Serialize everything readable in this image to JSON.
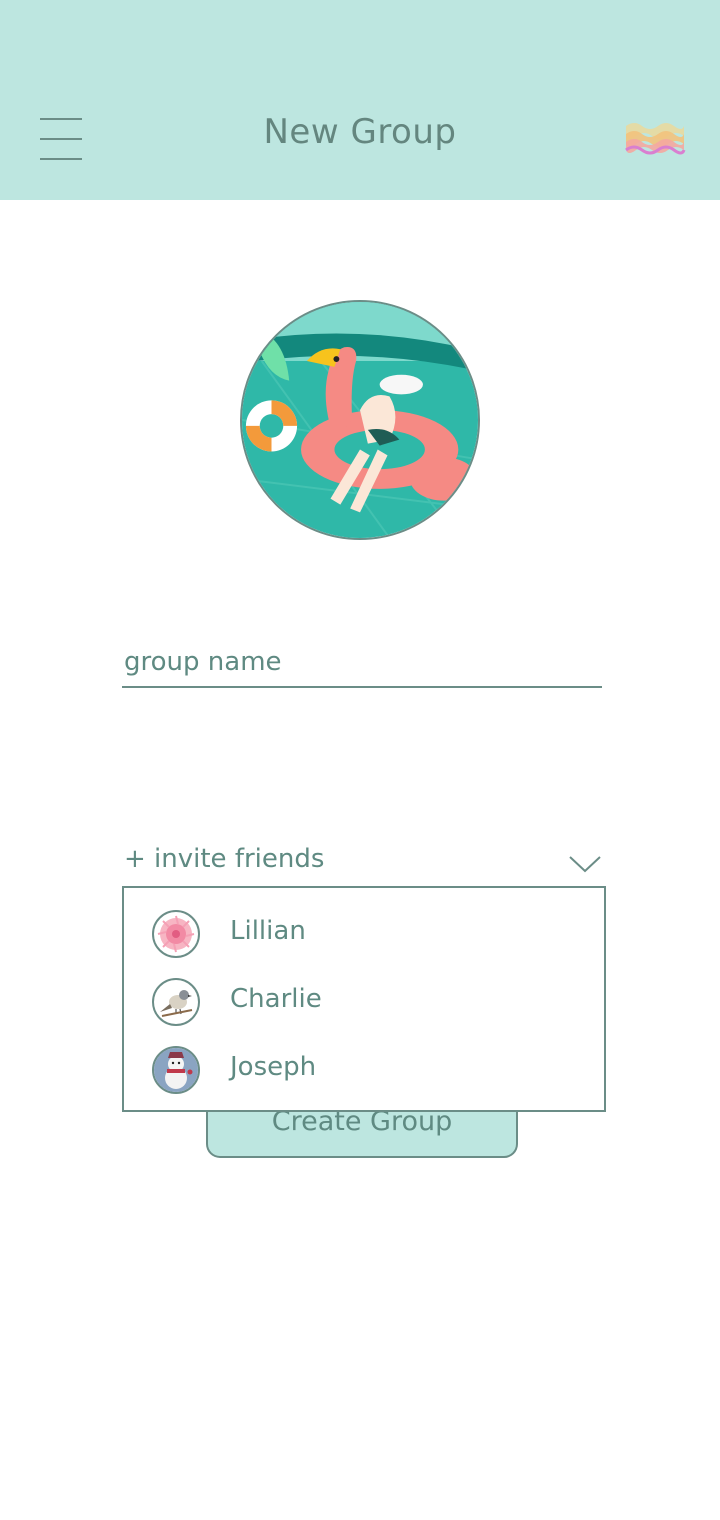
{
  "header": {
    "title": "New Group",
    "menu_icon": "hamburger-menu-icon",
    "action_icon": "rainbow-waves-icon",
    "background": "#bde6e0"
  },
  "group_avatar": {
    "icon": "flamingo-pool-illustration"
  },
  "group_name_field": {
    "value": "",
    "placeholder": "group name"
  },
  "invite": {
    "label": "+ invite friends",
    "toggle_icon": "chevron-down-icon",
    "friends": [
      {
        "name": "Lillian",
        "avatar_icon": "pink-flower-avatar"
      },
      {
        "name": "Charlie",
        "avatar_icon": "bird-avatar"
      },
      {
        "name": "Joseph",
        "avatar_icon": "snowman-avatar"
      }
    ]
  },
  "create_button": {
    "label": "Create Group"
  },
  "colors": {
    "accent": "#bde6e0",
    "text": "#5f8a82",
    "border": "#6b8d87"
  }
}
